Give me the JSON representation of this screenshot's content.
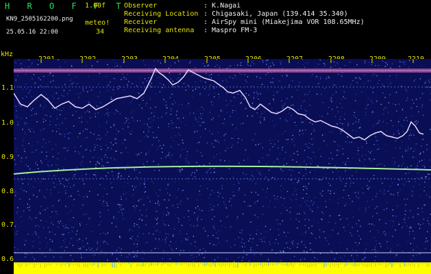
{
  "header": {
    "brand": "H R O F F T",
    "version": "1.00f",
    "filename": "KN9_2505162200.png",
    "meteo_label": "meteo!",
    "date": "25.05.16 22:00",
    "count": "34",
    "info": [
      {
        "label": "Observer",
        "value": ": K.Nagai"
      },
      {
        "label": "Receiving Location",
        "value": ": Chigasaki, Japan (139.414 35.340)"
      },
      {
        "label": "Receiver",
        "value": ": AirSpy mini (Miakejima VOR 108.65MHz)"
      },
      {
        "label": "Receiving antenna",
        "value": ": Maspro FM-3"
      }
    ]
  },
  "spectrogram": {
    "y_unit": "kHz",
    "y_ticks": [
      "1.1",
      "1.0",
      "0.9",
      "0.8",
      "0.7",
      "0.6"
    ],
    "x_ticks": [
      "2201",
      "2202",
      "2203",
      "2204",
      "2205",
      "2206",
      "2207",
      "2208",
      "2209",
      "2210"
    ],
    "colors": {
      "background": "#0a0f55",
      "noise": "#2a3fb0",
      "trace_line": "#e0f0ff",
      "carrier": "#9fe89f",
      "band": "#ffff00",
      "axis_text": "#e6e600"
    }
  }
}
